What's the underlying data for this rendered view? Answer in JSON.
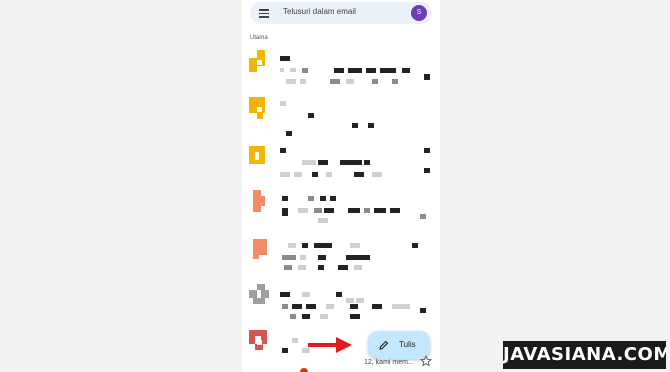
{
  "search": {
    "placeholder": "Telusuri dalam email"
  },
  "account": {
    "avatar_letter": "S",
    "avatar_color": "#6a3fb4"
  },
  "inbox": {
    "section_label": "Utama",
    "sender_colors": [
      "#f4b400",
      "#f4b400",
      "#f4b400",
      "#f28b67",
      "#f28b67",
      "#9e9e9e",
      "#d9534f"
    ]
  },
  "compose": {
    "label": "Tulis",
    "background": "#c2e7ff"
  },
  "last_row": {
    "snippet": "12, kami mem..."
  },
  "annotation": {
    "arrow_color": "#e01b1b"
  },
  "watermark": {
    "text": "JAVASIANA.COM"
  }
}
